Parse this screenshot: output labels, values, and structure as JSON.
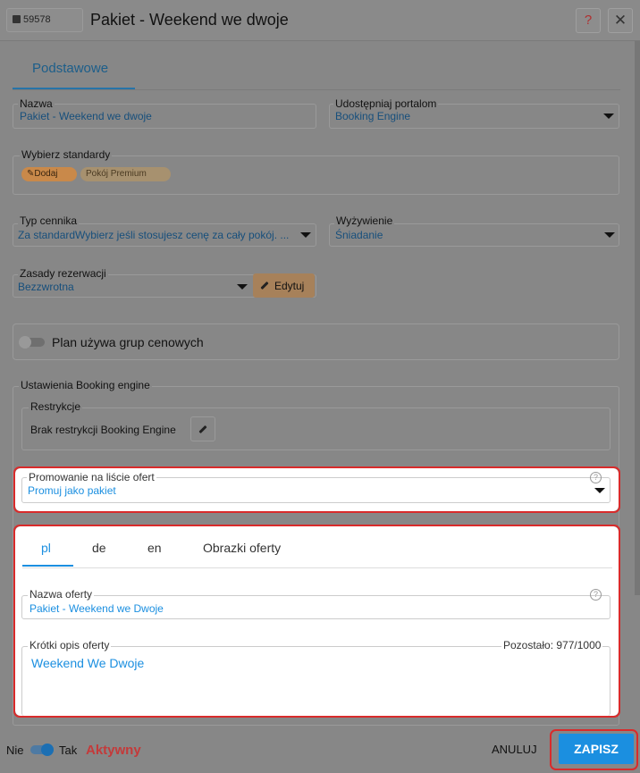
{
  "header": {
    "record_id": "59578",
    "title": "Pakiet - Weekend we dwoje",
    "help_icon": "?",
    "close_icon": "✕"
  },
  "tabs": {
    "main": "Podstawowe"
  },
  "form": {
    "name": {
      "label": "Nazwa",
      "value": "Pakiet - Weekend we dwoje"
    },
    "portals": {
      "label": "Udostępniaj portalom",
      "value": "Booking Engine"
    },
    "standards": {
      "label": "Wybierz standardy",
      "add_chip": "Dodaj",
      "chips": [
        "Pokój Premium"
      ]
    },
    "pricing_type": {
      "label": "Typ cennika",
      "value": "Za standardWybierz jeśli stosujesz cenę za cały pokój. ..."
    },
    "meals": {
      "label": "Wyżywienie",
      "value": "Śniadanie"
    },
    "rules": {
      "label": "Zasady rezerwacji",
      "value": "Bezzwrotna",
      "edit_label": "Edytuj"
    },
    "price_groups_toggle": {
      "label": "Plan używa grup cenowych",
      "enabled": false
    }
  },
  "booking_engine": {
    "section_label": "Ustawienia Booking engine",
    "restrictions": {
      "label": "Restrykcje",
      "value": "Brak restrykcji Booking Engine"
    },
    "promotion": {
      "label": "Promowanie na liście ofert",
      "value": "Promuj jako pakiet"
    }
  },
  "offer": {
    "lang_tabs": [
      "pl",
      "de",
      "en",
      "Obrazki oferty"
    ],
    "active_tab": "pl",
    "offer_name": {
      "label": "Nazwa oferty",
      "value": "Pakiet - Weekend we Dwoje"
    },
    "short_desc": {
      "label": "Krótki opis oferty",
      "remaining": "Pozostało: 977/1000",
      "value": "Weekend We Dwoje"
    }
  },
  "footer": {
    "no_label": "Nie",
    "yes_label": "Tak",
    "status": "Aktywny",
    "cancel": "ANULUJ",
    "save": "ZAPISZ"
  },
  "colors": {
    "accent": "#1b8fe0",
    "status_red": "#c43a3a",
    "frame_red": "#d92b2b",
    "chip_orange": "#c9894a"
  }
}
